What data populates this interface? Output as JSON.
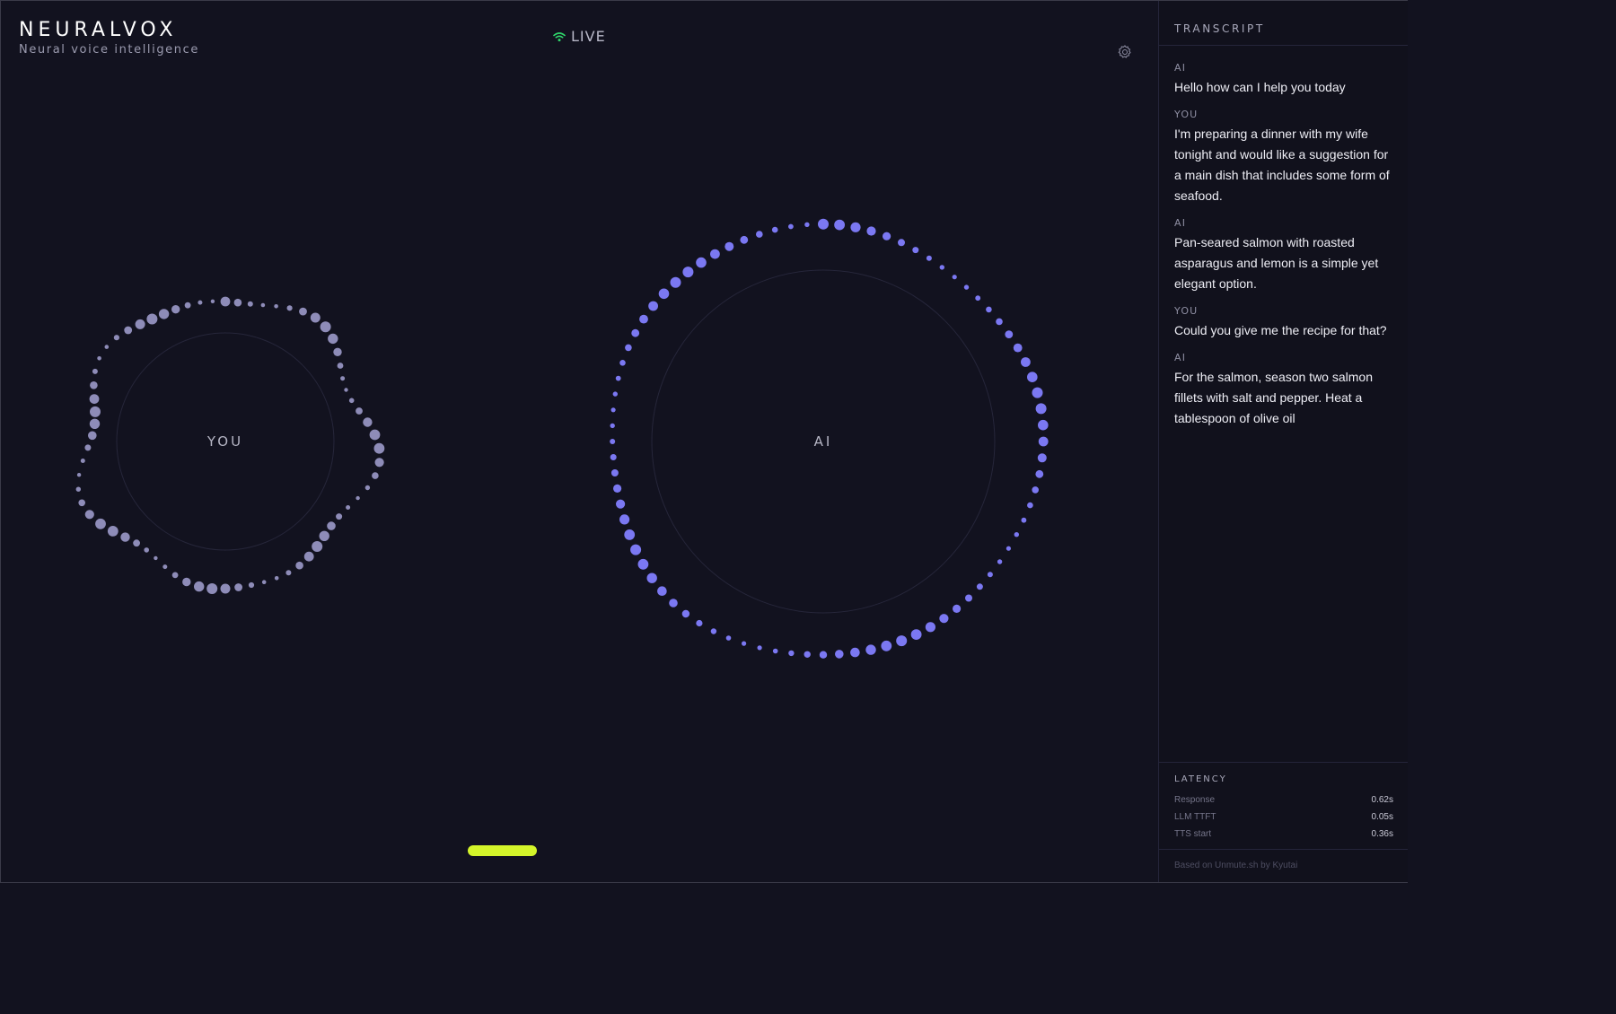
{
  "brand": {
    "title": "NEURALVOX",
    "subtitle": "Neural voice intelligence"
  },
  "status": {
    "label": "LIVE",
    "color": "#2fd66b",
    "icon": "wifi-icon"
  },
  "settings": {
    "icon": "gear-icon"
  },
  "orbs": {
    "you": {
      "label": "YOU",
      "dot_color": "#8e8cb8"
    },
    "ai": {
      "label": "AI",
      "dot_color": "#7b78f2"
    }
  },
  "mic": {
    "color": "#d4f52a"
  },
  "transcript": {
    "title": "TRANSCRIPT",
    "messages": [
      {
        "speaker": "AI",
        "text": "Hello how can I help you today"
      },
      {
        "speaker": "YOU",
        "text": "I'm preparing a dinner with my wife tonight and would like a suggestion for a main dish that includes some form of seafood."
      },
      {
        "speaker": "AI",
        "text": "Pan-seared salmon with roasted asparagus and lemon is a simple yet elegant option."
      },
      {
        "speaker": "YOU",
        "text": "Could you give me the recipe for that?"
      },
      {
        "speaker": "AI",
        "text": "For the salmon, season two salmon fillets with salt and pepper. Heat a tablespoon of olive oil"
      }
    ]
  },
  "latency": {
    "title": "LATENCY",
    "rows": [
      {
        "label": "Response",
        "value": "0.62s"
      },
      {
        "label": "LLM TTFT",
        "value": "0.05s"
      },
      {
        "label": "TTS start",
        "value": "0.36s"
      }
    ]
  },
  "footer": {
    "text": "Based on Unmute.sh by Kyutai"
  }
}
